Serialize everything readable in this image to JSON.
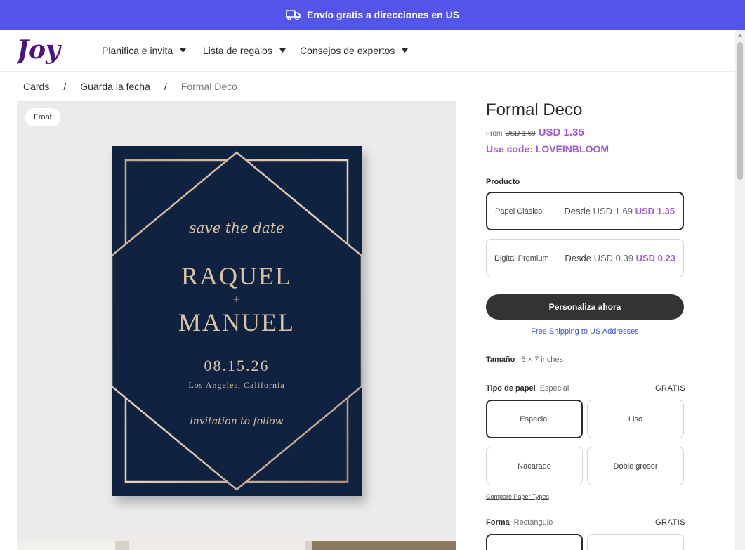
{
  "promo": {
    "text": "Envío gratis a direcciones en US",
    "icon": "truck-icon"
  },
  "nav": {
    "logo": "Joy",
    "items": [
      {
        "label": "Planifica e invita"
      },
      {
        "label": "Lista de regalos"
      },
      {
        "label": "Consejos de expertos"
      }
    ]
  },
  "breadcrumb": {
    "items": [
      "Cards",
      "Guarda la fecha"
    ],
    "separator": "/",
    "current": "Formal Deco"
  },
  "preview": {
    "badge": "Front",
    "card": {
      "save_the_date": "save the date",
      "name1": "RAQUEL",
      "plus": "+",
      "name2": "MANUEL",
      "date": "08.15.26",
      "location": "Los Angeles, California",
      "invitation": "invitation to follow"
    }
  },
  "product": {
    "title": "Formal Deco",
    "from_label": "From",
    "old_price": "USD 1.69",
    "price": "USD 1.35",
    "promo_code": "Use code: LOVEINBLOOM"
  },
  "producto": {
    "label": "Producto",
    "options": [
      {
        "name": "Papel Clásico",
        "from": "Desde",
        "old": "USD 1.69",
        "price": "USD 1.35",
        "selected": true
      },
      {
        "name": "Digital Premium",
        "from": "Desde",
        "old": "USD 0.39",
        "price": "USD 0.23",
        "selected": false
      }
    ]
  },
  "cta": {
    "label": "Personaliza ahora"
  },
  "shipping_link": "Free Shipping to US Addresses",
  "size": {
    "label": "Tamaño",
    "value": "5 × 7 inches"
  },
  "paper": {
    "label": "Tipo de papel",
    "value": "Especial",
    "badge": "GRATIS",
    "options": [
      {
        "label": "Especial",
        "selected": true
      },
      {
        "label": "Liso",
        "selected": false
      },
      {
        "label": "Nacarado",
        "selected": false
      },
      {
        "label": "Doble grosor",
        "selected": false
      }
    ],
    "compare": "Compare Paper Types"
  },
  "shape": {
    "label": "Forma",
    "value": "Rectángulo",
    "badge": "GRATIS"
  },
  "colors": {
    "promo": "#5254ea",
    "accent": "#9d5ad6",
    "cta": "#333333",
    "card": "#0f2340",
    "gold": "#d8c3a5",
    "link": "#3d4fd4"
  }
}
